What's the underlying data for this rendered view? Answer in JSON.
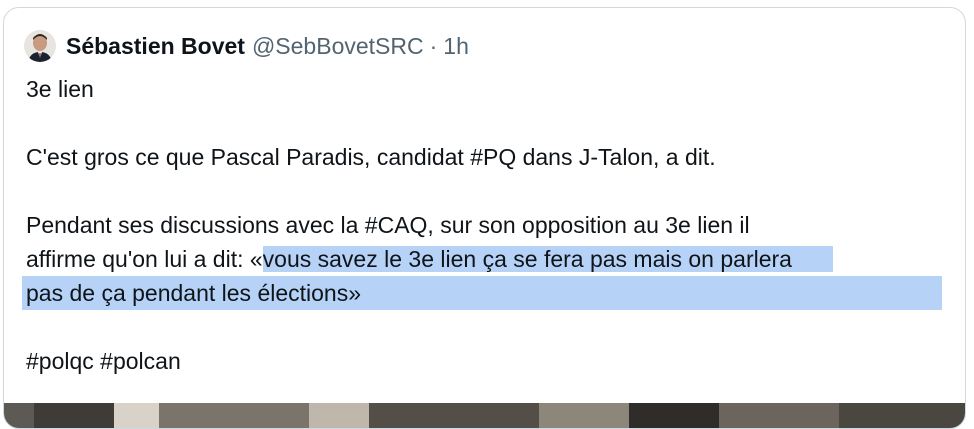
{
  "author": {
    "name": "Sébastien Bovet",
    "handle": "@SebBovetSRC",
    "separator": "·",
    "time": "1h"
  },
  "tweet": {
    "line1": "3e lien",
    "line2": "C'est gros ce que Pascal Paradis, candidat #PQ dans J-Talon, a dit.",
    "line3": "Pendant ses discussions avec la #CAQ, sur son opposition au 3e lien il",
    "line4_plain": "affirme qu'on lui a dit: «",
    "line4_highlight": "vous savez le 3e lien ça se fera pas mais on parlera",
    "line5_highlight": "pas de ça pendant les élections»",
    "hashtags": "#polqc #polcan"
  },
  "colors": {
    "selection": "#b6d3f7",
    "border": "#cfd9de",
    "secondary_text": "#536471"
  }
}
